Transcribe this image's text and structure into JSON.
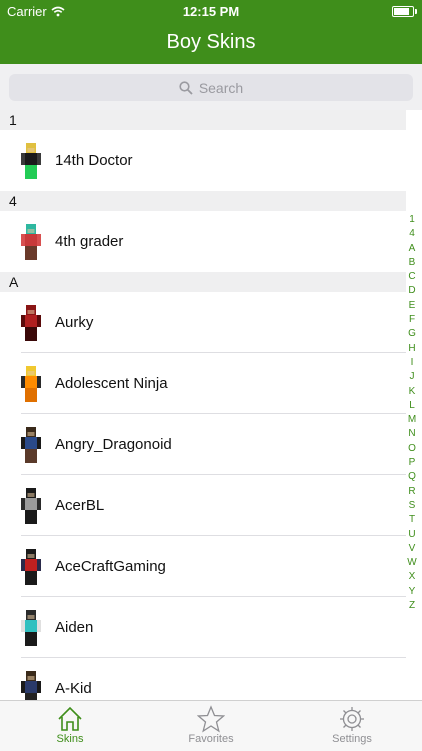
{
  "status": {
    "carrier": "Carrier",
    "time": "12:15 PM",
    "battery_level": 0.95
  },
  "nav": {
    "title": "Boy Skins"
  },
  "search": {
    "placeholder": "Search"
  },
  "sections": [
    {
      "header": "1",
      "items": [
        {
          "name": "14th Doctor",
          "colors": [
            "#e0c040",
            "#1a1a1a",
            "#3a3a3a",
            "#22cc55"
          ]
        }
      ]
    },
    {
      "header": "4",
      "items": [
        {
          "name": "4th grader",
          "colors": [
            "#2eb8a0",
            "#c83a3a",
            "#d85050",
            "#6a3a2a"
          ]
        }
      ]
    },
    {
      "header": "A",
      "items": [
        {
          "name": "Aurky",
          "colors": [
            "#8a1515",
            "#b02020",
            "#5a0a0a",
            "#3a0808"
          ]
        },
        {
          "name": "Adolescent Ninja",
          "colors": [
            "#f0c830",
            "#ff8c00",
            "#2a2a2a",
            "#e07000"
          ]
        },
        {
          "name": "Angry_Dragonoid",
          "colors": [
            "#3a2a1a",
            "#2a4a8a",
            "#1a1a1a",
            "#5a3a2a"
          ]
        },
        {
          "name": "AcerBL",
          "colors": [
            "#1a1a1a",
            "#9a9a9a",
            "#2a2a2a",
            "#1a1a1a"
          ]
        },
        {
          "name": "AceCraftGaming",
          "colors": [
            "#1a1a1a",
            "#c02020",
            "#2a2a4a",
            "#1a1a1a"
          ]
        },
        {
          "name": "Aiden",
          "colors": [
            "#2a2a2a",
            "#30c0c0",
            "#e0e0e0",
            "#1a1a1a"
          ]
        },
        {
          "name": "A-Kid",
          "colors": [
            "#3a2a1a",
            "#2a3a6a",
            "#1a1a1a",
            "#222222"
          ]
        }
      ]
    }
  ],
  "index_letters": [
    "1",
    "4",
    "A",
    "B",
    "C",
    "D",
    "E",
    "F",
    "G",
    "H",
    "I",
    "J",
    "K",
    "L",
    "M",
    "N",
    "O",
    "P",
    "Q",
    "R",
    "S",
    "T",
    "U",
    "V",
    "W",
    "X",
    "Y",
    "Z"
  ],
  "tabs": [
    {
      "label": "Skins",
      "icon": "home-icon",
      "active": true
    },
    {
      "label": "Favorites",
      "icon": "star-icon",
      "active": false
    },
    {
      "label": "Settings",
      "icon": "gear-icon",
      "active": false
    }
  ],
  "colors": {
    "accent": "#3f8e1b",
    "tab_inactive": "#8f8f93"
  }
}
